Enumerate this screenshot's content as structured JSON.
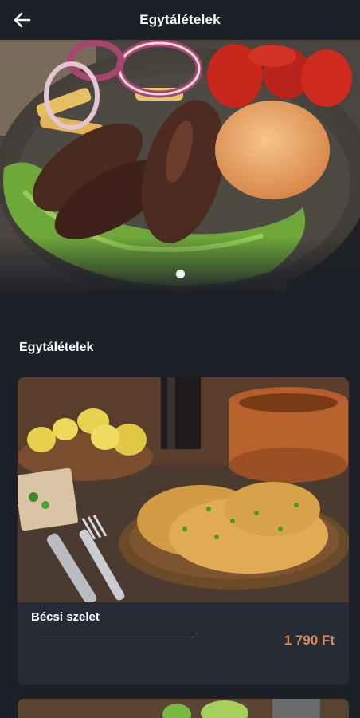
{
  "header": {
    "title": "Egytálételek",
    "back_icon": "arrow-left-icon"
  },
  "carousel": {
    "slide_count": 1,
    "active_index": 0
  },
  "section": {
    "title": "Egytálételek"
  },
  "items": [
    {
      "name": "Bécsi szelet",
      "price": "1 790 Ft"
    }
  ],
  "colors": {
    "background": "#1d2027",
    "card": "#272b35",
    "price": "#e08a5a"
  }
}
